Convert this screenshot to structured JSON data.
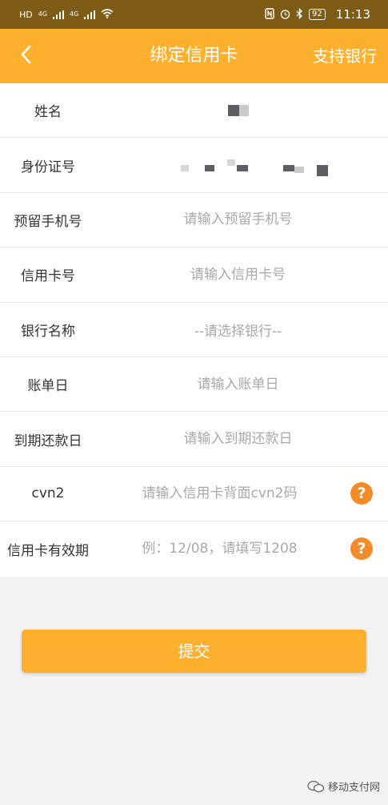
{
  "status_bar": {
    "left_label": "HD",
    "net1": "4G",
    "net2": "4G",
    "battery": "92",
    "time": "11:13"
  },
  "header": {
    "back_icon": "chevron-left-icon",
    "title": "绑定信用卡",
    "support_link": "支持银行"
  },
  "form": {
    "name": {
      "label": "姓名"
    },
    "id_number": {
      "label": "身份证号"
    },
    "phone": {
      "label": "预留手机号",
      "placeholder": "请输入预留手机号"
    },
    "card_number": {
      "label": "信用卡号",
      "placeholder": "请输入信用卡号"
    },
    "bank_name": {
      "label": "银行名称",
      "value": "--请选择银行--"
    },
    "bill_day": {
      "label": "账单日",
      "placeholder": "请输入账单日"
    },
    "due_day": {
      "label": "到期还款日",
      "placeholder": "请输入到期还款日"
    },
    "cvn2": {
      "label": "cvn2",
      "placeholder": "请输入信用卡背面cvn2码",
      "help": "?"
    },
    "expiry": {
      "label": "信用卡有效期",
      "placeholder": "例：12/08，请填写1208",
      "help": "?"
    }
  },
  "submit_label": "提交",
  "watermark": "移动支付网",
  "colors": {
    "primary": "#fdb02e",
    "help_icon": "#f48b2a",
    "status_bar": "#7e5c16",
    "background": "#f2f2f4"
  }
}
